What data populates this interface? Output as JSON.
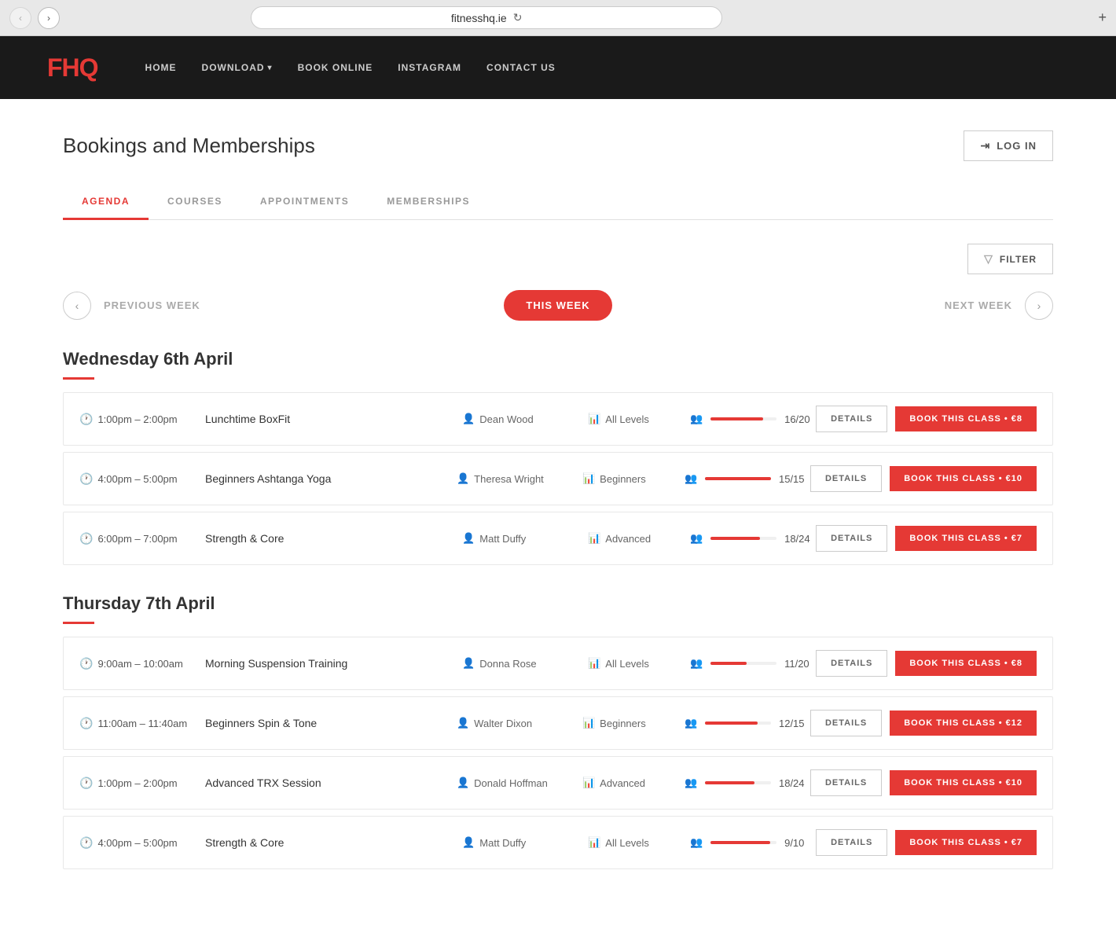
{
  "browser": {
    "back_btn": "‹",
    "forward_btn": "›",
    "url": "fitnesshq.ie",
    "reload_icon": "↻",
    "add_tab": "+"
  },
  "header": {
    "logo_text": "FHQ",
    "nav_items": [
      {
        "label": "HOME",
        "has_dropdown": false
      },
      {
        "label": "DOWNLOAD",
        "has_dropdown": true
      },
      {
        "label": "BOOK ONLINE",
        "has_dropdown": false
      },
      {
        "label": "INSTAGRAM",
        "has_dropdown": false
      },
      {
        "label": "CONTACT US",
        "has_dropdown": false
      }
    ]
  },
  "page": {
    "title": "Bookings and Memberships",
    "login_label": "LOG IN",
    "login_icon": "⇥"
  },
  "tabs": [
    {
      "id": "agenda",
      "label": "AGENDA",
      "active": true
    },
    {
      "id": "courses",
      "label": "COURSES",
      "active": false
    },
    {
      "id": "appointments",
      "label": "APPOINTMENTS",
      "active": false
    },
    {
      "id": "memberships",
      "label": "MEMBERSHIPS",
      "active": false
    }
  ],
  "filter_btn": "FILTER",
  "week_nav": {
    "prev_label": "PREVIOUS WEEK",
    "this_week_label": "THIS WEEK",
    "next_label": "NEXT WEEK"
  },
  "days": [
    {
      "heading": "Wednesday 6th April",
      "classes": [
        {
          "time": "1:00pm – 2:00pm",
          "name": "Lunchtime BoxFit",
          "instructor": "Dean Wood",
          "level": "All Levels",
          "capacity_filled": 16,
          "capacity_total": 20,
          "capacity_pct": 80,
          "price": "€8",
          "details_label": "DETAILS",
          "book_label": "BOOK THIS CLASS • €8"
        },
        {
          "time": "4:00pm – 5:00pm",
          "name": "Beginners Ashtanga Yoga",
          "instructor": "Theresa Wright",
          "level": "Beginners",
          "capacity_filled": 15,
          "capacity_total": 15,
          "capacity_pct": 100,
          "price": "€10",
          "details_label": "DETAILS",
          "book_label": "BOOK THIS CLASS • €10"
        },
        {
          "time": "6:00pm – 7:00pm",
          "name": "Strength & Core",
          "instructor": "Matt Duffy",
          "level": "Advanced",
          "capacity_filled": 18,
          "capacity_total": 24,
          "capacity_pct": 75,
          "price": "€7",
          "details_label": "DETAILS",
          "book_label": "BOOK THIS CLASS • €7"
        }
      ]
    },
    {
      "heading": "Thursday 7th April",
      "classes": [
        {
          "time": "9:00am – 10:00am",
          "name": "Morning Suspension Training",
          "instructor": "Donna Rose",
          "level": "All Levels",
          "capacity_filled": 11,
          "capacity_total": 20,
          "capacity_pct": 55,
          "price": "€8",
          "details_label": "DETAILS",
          "book_label": "BOOK THIS CLASS • €8"
        },
        {
          "time": "11:00am – 11:40am",
          "name": "Beginners Spin & Tone",
          "instructor": "Walter Dixon",
          "level": "Beginners",
          "capacity_filled": 12,
          "capacity_total": 15,
          "capacity_pct": 80,
          "price": "€12",
          "details_label": "DETAILS",
          "book_label": "BOOK THIS CLASS • €12"
        },
        {
          "time": "1:00pm – 2:00pm",
          "name": "Advanced TRX Session",
          "instructor": "Donald Hoffman",
          "level": "Advanced",
          "capacity_filled": 18,
          "capacity_total": 24,
          "capacity_pct": 75,
          "price": "€10",
          "details_label": "DETAILS",
          "book_label": "BOOK THIS CLASS • €10"
        },
        {
          "time": "4:00pm – 5:00pm",
          "name": "Strength & Core",
          "instructor": "Matt Duffy",
          "level": "All Levels",
          "capacity_filled": 9,
          "capacity_total": 10,
          "capacity_pct": 90,
          "price": "€7",
          "details_label": "DETAILS",
          "book_label": "BOOK THIS CLASS • €7"
        }
      ]
    }
  ]
}
